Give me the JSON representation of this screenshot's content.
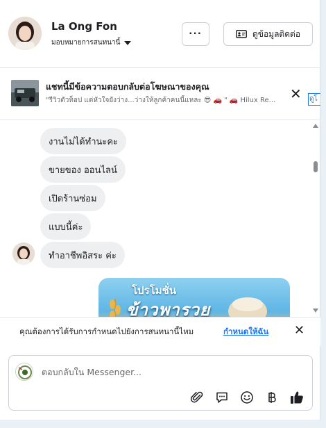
{
  "header": {
    "name": "La Ong Fon",
    "assign_label": "มอบหมายการสนทนานี้",
    "more_label": "···",
    "contact_label": "ดูข้อมูลติดต่อ"
  },
  "ad": {
    "title": "แชทนี้มีข้อความตอบกลับต่อโฆษณาของคุณ",
    "subtitle": "\"รีวิวตัวท็อป แต่หัวใจยังว่าง...ว่างให้ลูกค้าคนนี้แหละ 😎 🚗 \" 🚗 Hilux Re...",
    "clip_text": "ดูโ"
  },
  "messages": [
    {
      "text": "งานไม่ได้ทำนะคะ"
    },
    {
      "text": "ขายของ ออนไลน์"
    },
    {
      "text": "เปิดร้านซ่อม"
    },
    {
      "text": "แบบนี้ค่ะ"
    },
    {
      "text": "ทำอาชีพอิสระ ค่ะ"
    }
  ],
  "promo": {
    "line1": "โปรโมชั่น",
    "line2": "ข้าวพารวย"
  },
  "assign_prompt": {
    "question": "คุณต้องการได้รับการกำหนดไปยังการสนทนานี้ไหม",
    "link": "กำหนดให้ฉัน"
  },
  "composer": {
    "placeholder": "ตอบกลับใน Messenger..."
  },
  "colors": {
    "accent": "#1877f2",
    "bubble": "#eeeff1",
    "page_bg": "#e9f1f6"
  }
}
